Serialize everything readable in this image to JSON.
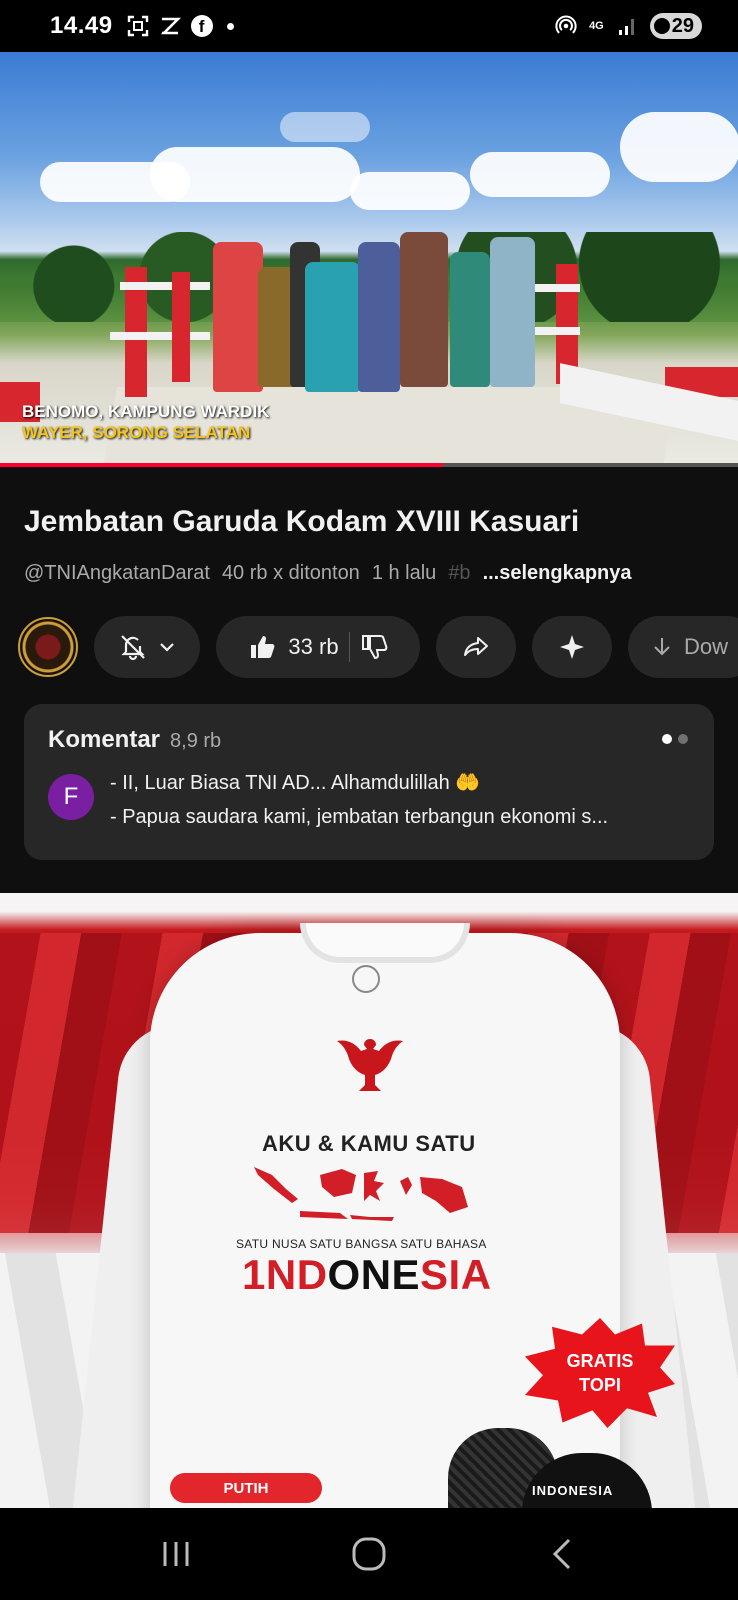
{
  "status_bar": {
    "time": "14.49",
    "network": "4G",
    "battery": "29"
  },
  "video": {
    "caption_line1": "BENOMO, KAMPUNG WARDIK",
    "caption_line2": "WAYER, SORONG SELATAN"
  },
  "details": {
    "title": "Jembatan Garuda Kodam XVIII Kasuari",
    "channel_handle": "@TNIAngkatanDarat",
    "views": "40 rb x ditonton",
    "age": "1 h lalu",
    "hashtag_fragment": "#b",
    "more_label": "...selengkapnya"
  },
  "actions": {
    "like_count": "33 rb",
    "download_label": "Dow"
  },
  "comments": {
    "label": "Komentar",
    "count": "8,9 rb",
    "avatar_letter": "F",
    "line1": "- II, Luar Biasa TNI AD... Alhamdulillah 🤲",
    "line2": "- Papua saudara kami, jembatan terbangun ekonomi s..."
  },
  "ad": {
    "headline": "AKU & KAMU SATU",
    "tagline": "SATU NUSA SATU BANGSA SATU BAHASA",
    "brand_part1": "1ND",
    "brand_part2": "ONE",
    "brand_part3": "SIA",
    "burst_line1": "GRATIS",
    "burst_line2": "TOPI",
    "color_label": "PUTIH",
    "cap_text": "INDONESIA"
  },
  "colors": {
    "background": "#0f0f0f",
    "surface": "#272727",
    "accent_red": "#ff0033",
    "caption_yellow": "#f5c518"
  }
}
